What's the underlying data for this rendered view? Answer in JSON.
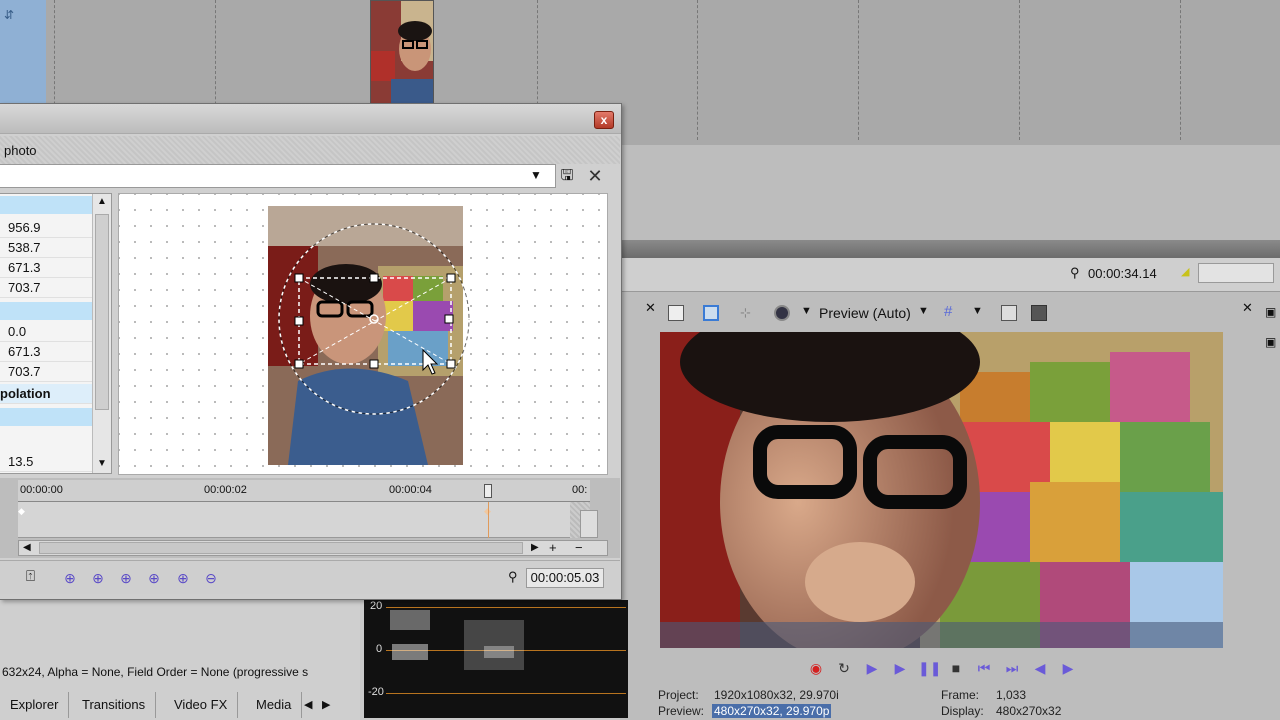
{
  "timeline": {
    "cursor_time": "00:00:34.14"
  },
  "dialog": {
    "close_label": "x",
    "fx_name": "photo",
    "preset_value": "",
    "save_icon": "save-icon",
    "delete_icon": "delete-icon",
    "properties": [
      {
        "value": "956.9"
      },
      {
        "value": "538.7"
      },
      {
        "value": "671.3"
      },
      {
        "value": "703.7"
      },
      {
        "value": "0.0"
      },
      {
        "value": "671.3"
      },
      {
        "value": "703.7"
      }
    ],
    "section_label": "polation",
    "last_value": "13.5",
    "keyframe_ruler": [
      "00:00:00",
      "00:00:02",
      "00:00:04",
      "00:"
    ],
    "cursor_time": "00:00:05.03"
  },
  "preview": {
    "mode_label": "Preview (Auto)",
    "project_label": "Project:",
    "project_value": "1920x1080x32, 29.970i",
    "preview_label": "Preview:",
    "preview_value": "480x270x32, 29.970p",
    "frame_label": "Frame:",
    "frame_value": "1,033",
    "display_label": "Display:",
    "display_value": "480x270x32"
  },
  "status_line": "632x24, Alpha = None, Field Order = None (progressive s",
  "dock_tabs": [
    "Explorer",
    "Transitions",
    "Video FX",
    "Media"
  ],
  "scope": {
    "labels": [
      "20",
      "0",
      "-20"
    ]
  },
  "colors": {
    "accent": "#4a6ea9",
    "keyframe": "#5a4ac7",
    "close": "#c0402e",
    "scope_line": "#b8741f"
  }
}
